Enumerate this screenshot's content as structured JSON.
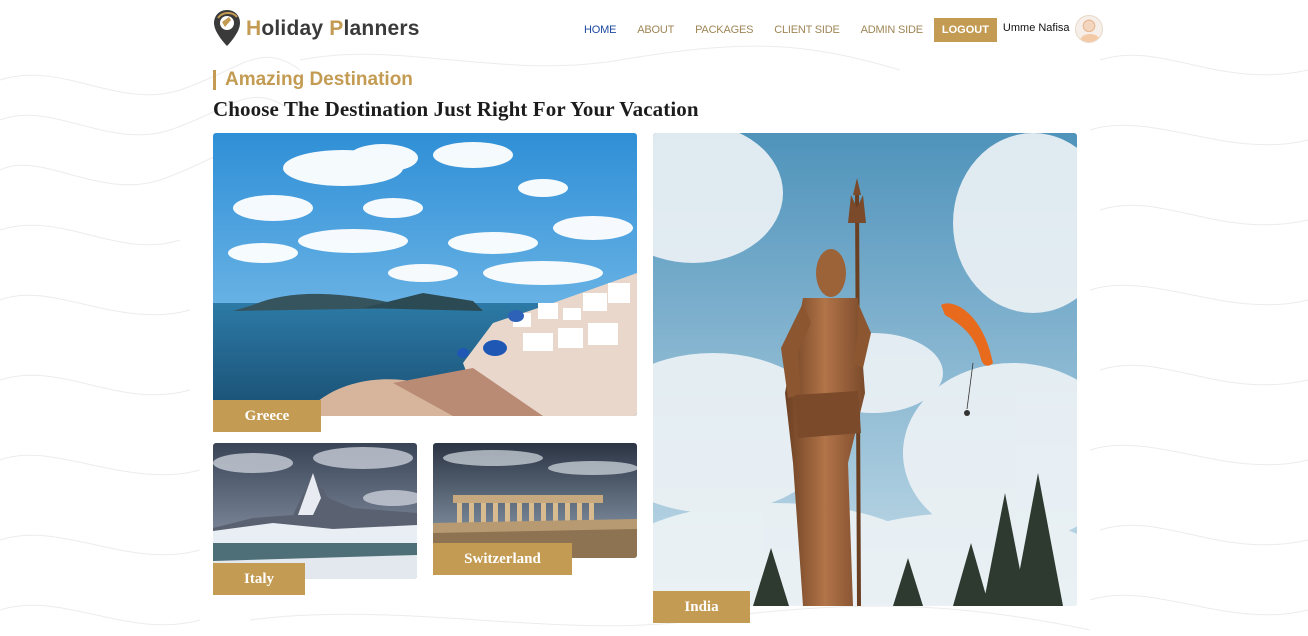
{
  "brand": {
    "name_first_cap": "H",
    "name_first_rest": "oliday ",
    "name_second_cap": "P",
    "name_second_rest": "lanners",
    "accent": "#c39b52"
  },
  "nav": {
    "items": [
      {
        "label": "HOME",
        "active": true
      },
      {
        "label": "ABOUT",
        "active": false
      },
      {
        "label": "PACKAGES",
        "active": false
      },
      {
        "label": "CLIENT SIDE",
        "active": false
      },
      {
        "label": "ADMIN SIDE",
        "active": false
      }
    ],
    "logout_label": "LOGOUT",
    "user_name": "Umme Nafisa"
  },
  "section": {
    "eyebrow": "Amazing Destination",
    "title": "Choose The Destination Just Right For Your Vacation"
  },
  "destinations": [
    {
      "name": "Greece",
      "image": "santorini-coast"
    },
    {
      "name": "Italy",
      "image": "snowy-mountain-lake"
    },
    {
      "name": "Switzerland",
      "image": "ancient-temple-ruins"
    },
    {
      "name": "India",
      "image": "shiva-statue-paraglider"
    }
  ]
}
